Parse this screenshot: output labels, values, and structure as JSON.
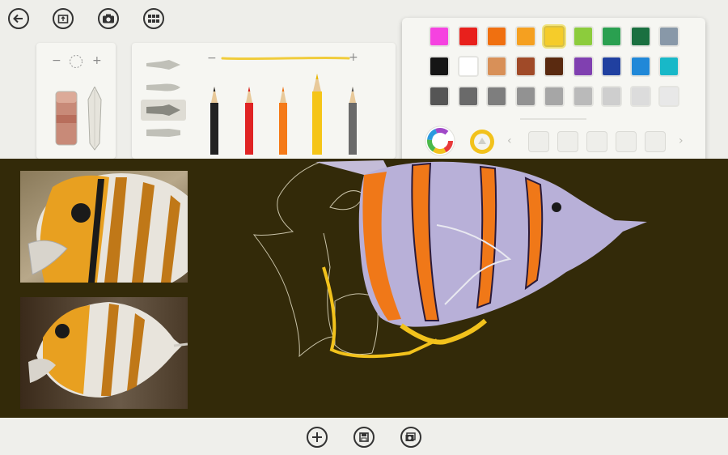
{
  "toolbar": {
    "back_icon": "back-arrow-icon",
    "import_icon": "import-photo-icon",
    "camera_icon": "camera-icon",
    "gallery_icon": "gallery-grid-icon"
  },
  "eraser_panel": {
    "minus": "−",
    "plus": "+",
    "tool": "eraser"
  },
  "pencil_panel": {
    "minus": "−",
    "plus": "+",
    "brush_types": [
      "fine-brush",
      "round-brush",
      "chisel-brush",
      "flat-brush"
    ],
    "selected_brush": "chisel-brush",
    "pencils": [
      "black",
      "red",
      "orange",
      "yellow",
      "gray"
    ],
    "stroke_color": "#f0cc3c"
  },
  "palette": {
    "rows": [
      [
        "#f542e0",
        "#e8201c",
        "#f07010",
        "#f5a020",
        "#f5cc2a",
        "#8ccc3c",
        "#2aa050",
        "#1a7040",
        "#8898a8"
      ],
      [
        "#151515",
        "#ffffff",
        "#d89058",
        "#a04a28",
        "#5a2a10",
        "#8040b0",
        "#2040a0",
        "#2088d8",
        "#18b8c8"
      ],
      [
        "#555555",
        "#6a6a6a",
        "#7e7e7e",
        "#929292",
        "#a6a6a6",
        "#bababa",
        "#cecece",
        "#dcdcdc",
        "#e8e8e8"
      ]
    ],
    "selected_color": "#f5cc2a",
    "color_wheel_icon": "color-wheel-icon",
    "eyedropper_icon": "color-picker-icon",
    "prev_arrow": "‹",
    "next_arrow": "›"
  },
  "bottom": {
    "add_icon": "add-icon",
    "save_icon": "save-icon",
    "share_icon": "photos-icon"
  },
  "colors": {
    "canvas_bg": "#332a09",
    "bar_bg": "#eeeeea"
  }
}
